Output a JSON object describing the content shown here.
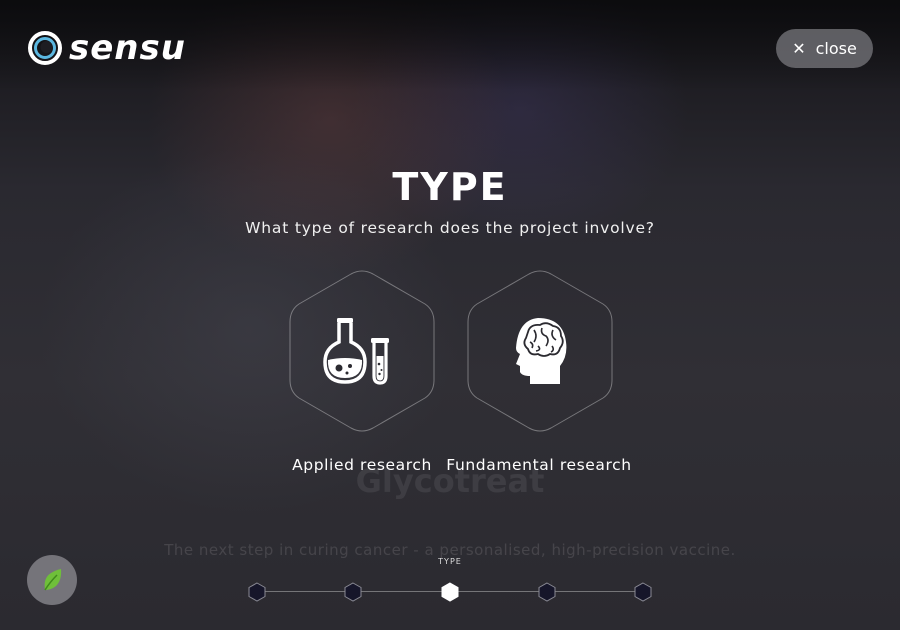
{
  "brand": {
    "name": "sensu",
    "icon": "ring-logo-icon",
    "accent": "#5bb7e0"
  },
  "header": {
    "close_label": "close",
    "close_icon": "close-icon"
  },
  "background": {
    "project_title": "Glycotreat",
    "project_subtitle": "The next step in curing cancer - a personalised, high-precision vaccine."
  },
  "step": {
    "title": "TYPE",
    "question": "What type of research does the project involve?",
    "options": [
      {
        "label": "Applied research",
        "icon": "flask-icon"
      },
      {
        "label": "Fundamental research",
        "icon": "brain-head-icon"
      }
    ]
  },
  "progress": {
    "current_label": "TYPE",
    "total_steps": 5,
    "current_step": 3
  },
  "floating": {
    "icon": "leaf-icon",
    "color": "#6fbf3a"
  }
}
